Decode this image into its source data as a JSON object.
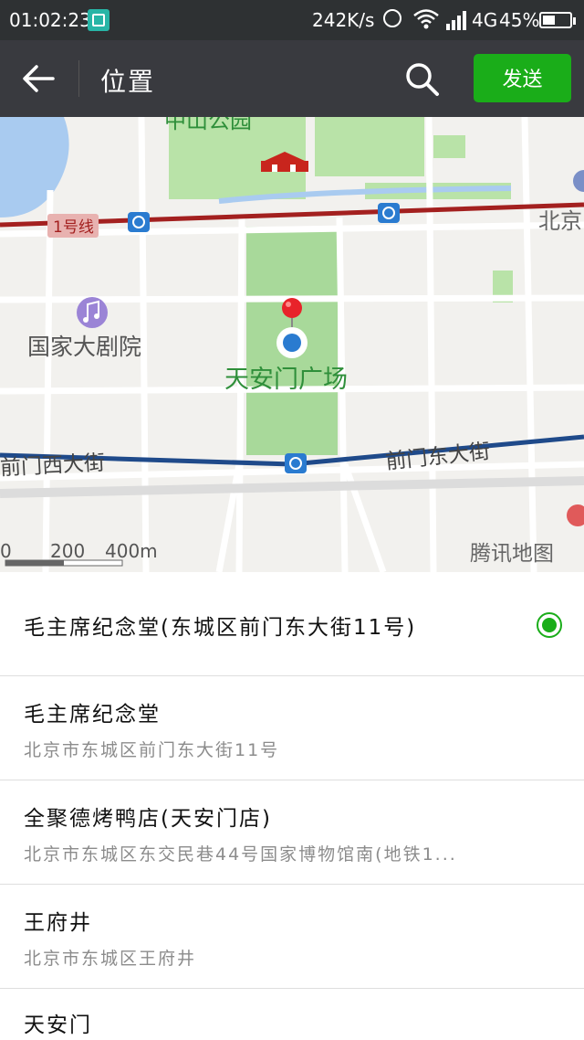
{
  "status_bar": {
    "time": "01:02:23",
    "net_speed": "242K/s",
    "network": "4G",
    "battery_pct": "45%",
    "battery_level": 0.45
  },
  "header": {
    "title": "位置",
    "send_label": "发送"
  },
  "map": {
    "labels": {
      "park": "中山公园",
      "metro_line": "1号线",
      "beijing": "北京",
      "theater": "国家大剧院",
      "square": "天安门广场",
      "west_street": "前门西大街",
      "east_street": "前门东大街",
      "scale_0": "0",
      "scale_200": "200",
      "scale_400": "400m",
      "watermark": "腾讯地图"
    },
    "colors": {
      "park": "#a8d99a",
      "metro_red": "#a3201f",
      "metro_blue": "#1f4a8a",
      "water": "#a9cbf0",
      "pin": "#e8232a",
      "label_green": "#2f8f3a"
    }
  },
  "places": [
    {
      "title": "毛主席纪念堂(东城区前门东大街11号)",
      "selected": true
    },
    {
      "title": "毛主席纪念堂",
      "address": "北京市东城区前门东大街11号"
    },
    {
      "title": "全聚德烤鸭店(天安门店)",
      "address": "北京市东城区东交民巷44号国家博物馆南(地铁1..."
    },
    {
      "title": "王府井",
      "address": "北京市东城区王府井"
    },
    {
      "title": "天安门"
    }
  ],
  "accent": "#1aad19"
}
